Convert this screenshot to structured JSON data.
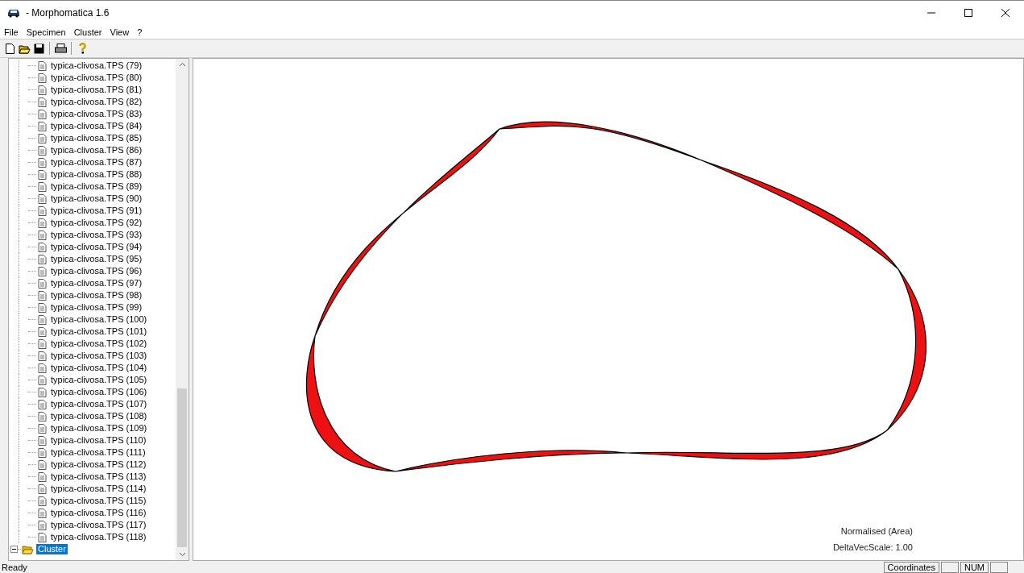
{
  "window": {
    "title": "- Morphomatica 1.6"
  },
  "menu": [
    {
      "label": "File"
    },
    {
      "label": "Specimen"
    },
    {
      "label": "Cluster"
    },
    {
      "label": "View"
    },
    {
      "label": "?"
    }
  ],
  "tree": {
    "items": [
      {
        "label": "typica-clivosa.TPS (79)",
        "selected": false
      },
      {
        "label": "typica-clivosa.TPS (80)",
        "selected": false
      },
      {
        "label": "typica-clivosa.TPS (81)",
        "selected": false
      },
      {
        "label": "typica-clivosa.TPS (82)",
        "selected": false
      },
      {
        "label": "typica-clivosa.TPS (83)",
        "selected": false
      },
      {
        "label": "typica-clivosa.TPS (84)",
        "selected": false
      },
      {
        "label": "typica-clivosa.TPS (85)",
        "selected": false
      },
      {
        "label": "typica-clivosa.TPS (86)",
        "selected": false
      },
      {
        "label": "typica-clivosa.TPS (87)",
        "selected": false
      },
      {
        "label": "typica-clivosa.TPS (88)",
        "selected": false
      },
      {
        "label": "typica-clivosa.TPS (89)",
        "selected": false
      },
      {
        "label": "typica-clivosa.TPS (90)",
        "selected": false
      },
      {
        "label": "typica-clivosa.TPS (91)",
        "selected": false
      },
      {
        "label": "typica-clivosa.TPS (92)",
        "selected": false
      },
      {
        "label": "typica-clivosa.TPS (93)",
        "selected": false
      },
      {
        "label": "typica-clivosa.TPS (94)",
        "selected": false
      },
      {
        "label": "typica-clivosa.TPS (95)",
        "selected": false
      },
      {
        "label": "typica-clivosa.TPS (96)",
        "selected": false
      },
      {
        "label": "typica-clivosa.TPS (97)",
        "selected": false
      },
      {
        "label": "typica-clivosa.TPS (98)",
        "selected": false
      },
      {
        "label": "typica-clivosa.TPS (99)",
        "selected": false
      },
      {
        "label": "typica-clivosa.TPS (100)",
        "selected": false
      },
      {
        "label": "typica-clivosa.TPS (101)",
        "selected": false
      },
      {
        "label": "typica-clivosa.TPS (102)",
        "selected": false
      },
      {
        "label": "typica-clivosa.TPS (103)",
        "selected": false
      },
      {
        "label": "typica-clivosa.TPS (104)",
        "selected": false
      },
      {
        "label": "typica-clivosa.TPS (105)",
        "selected": false
      },
      {
        "label": "typica-clivosa.TPS (106)",
        "selected": false
      },
      {
        "label": "typica-clivosa.TPS (107)",
        "selected": false
      },
      {
        "label": "typica-clivosa.TPS (108)",
        "selected": false
      },
      {
        "label": "typica-clivosa.TPS (109)",
        "selected": false
      },
      {
        "label": "typica-clivosa.TPS (110)",
        "selected": false
      },
      {
        "label": "typica-clivosa.TPS (111)",
        "selected": false
      },
      {
        "label": "typica-clivosa.TPS (112)",
        "selected": false
      },
      {
        "label": "typica-clivosa.TPS (113)",
        "selected": false
      },
      {
        "label": "typica-clivosa.TPS (114)",
        "selected": false
      },
      {
        "label": "typica-clivosa.TPS (115)",
        "selected": false
      },
      {
        "label": "typica-clivosa.TPS (116)",
        "selected": false
      },
      {
        "label": "typica-clivosa.TPS (117)",
        "selected": false
      },
      {
        "label": "typica-clivosa.TPS (118)",
        "selected": false
      }
    ],
    "cluster": {
      "label": "Cluster",
      "expanded": true,
      "selected": true
    }
  },
  "canvas": {
    "info": [
      "Normalised (Area)",
      "DeltaVecScale: 1.00"
    ]
  },
  "status_bar": {
    "message": "Ready",
    "panels": [
      {
        "kind": "text",
        "text": "Coordinates"
      },
      {
        "kind": "blank"
      },
      {
        "kind": "text",
        "text": "NUM"
      },
      {
        "kind": "blank"
      }
    ]
  }
}
